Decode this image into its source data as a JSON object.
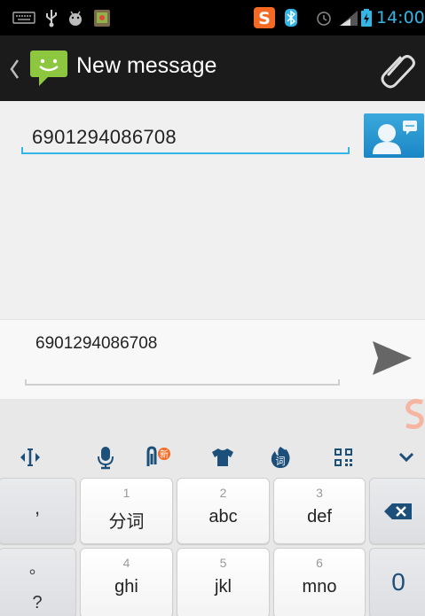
{
  "status_bar": {
    "time": "14:00",
    "icons": [
      "keyboard-icon",
      "usb-icon",
      "android-debug-icon",
      "gallery-icon",
      "sogou-icon",
      "bluetooth-icon",
      "alarm-icon",
      "signal-icon",
      "battery-charging-icon"
    ]
  },
  "action_bar": {
    "title": "New message"
  },
  "recipient": {
    "value": "6901294086708"
  },
  "compose": {
    "value": "6901294086708"
  },
  "ime_toolbar": {
    "icons": [
      "cursor-move-icon",
      "microphone-icon",
      "clipboard-icon",
      "skin-shirt-icon",
      "phrase-icon",
      "qr-code-icon",
      "collapse-keyboard-icon"
    ]
  },
  "keyboard": {
    "row1": {
      "side_key": ",",
      "keys": [
        {
          "num": "1",
          "label": "分词"
        },
        {
          "num": "2",
          "label": "abc"
        },
        {
          "num": "3",
          "label": "def"
        }
      ]
    },
    "row2": {
      "side_key_top": "。",
      "side_key_bottom": "?",
      "keys": [
        {
          "num": "4",
          "label": "ghi"
        },
        {
          "num": "5",
          "label": "jkl"
        },
        {
          "num": "6",
          "label": "mno"
        }
      ],
      "right_key": "0"
    }
  },
  "colors": {
    "accent": "#33b5e5",
    "action_bar": "#1b1b1b",
    "status_bar": "#000000"
  }
}
